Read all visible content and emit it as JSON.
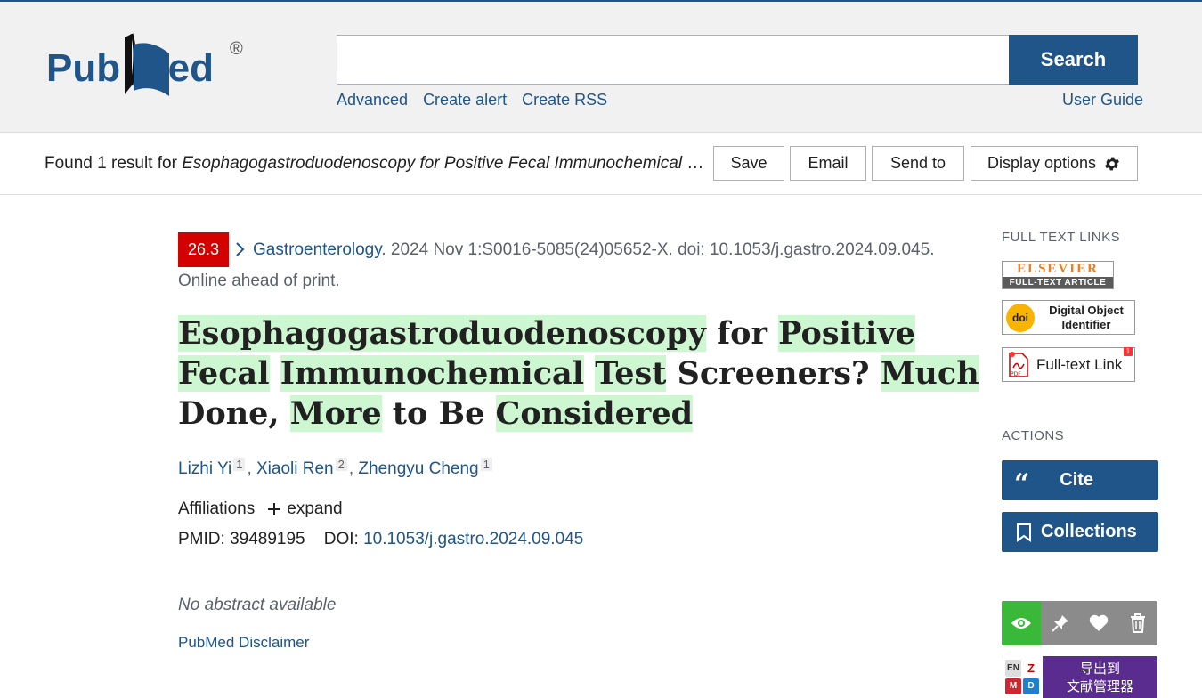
{
  "header": {
    "logo_text_left": "Pub",
    "logo_text_right": "Med",
    "logo_reg": "®",
    "search_value": "",
    "search_button": "Search",
    "links": [
      "Advanced",
      "Create alert",
      "Create RSS"
    ],
    "user_guide": "User Guide"
  },
  "results_bar": {
    "found_prefix": "Found 1 result for ",
    "query": "Esophagogastroduodenoscopy for Positive Fecal Immunochemical Test Screeners? Much Done, More to Be Considered",
    "save": "Save",
    "email": "Email",
    "send_to": "Send to",
    "display_options": "Display options"
  },
  "article": {
    "impact_factor": "26.3",
    "journal": "Gastroenterology",
    "citation": ". 2024 Nov 1:S0016-5085(24)05652-X. doi: 10.1053/j.gastro.2024.09.045.",
    "status": "Online ahead of print.",
    "title_words": [
      {
        "text": "Esophagogastroduodenoscopy",
        "hl": true
      },
      {
        "text": "for",
        "hl": false
      },
      {
        "text": "Positive",
        "hl": true
      },
      {
        "text": "Fecal",
        "hl": true
      },
      {
        "text": "Immunochemical",
        "hl": true
      },
      {
        "text": "Test",
        "hl": true
      },
      {
        "text": "Screeners?",
        "hl": false
      },
      {
        "text": "Much",
        "hl": true
      },
      {
        "text": "Done,",
        "hl": false
      },
      {
        "text": "More",
        "hl": true
      },
      {
        "text": "to",
        "hl": false
      },
      {
        "text": "Be",
        "hl": false
      },
      {
        "text": "Considered",
        "hl": true
      }
    ],
    "authors": [
      {
        "name": "Lizhi Yi",
        "aff": "1"
      },
      {
        "name": "Xiaoli Ren",
        "aff": "2"
      },
      {
        "name": "Zhengyu Cheng",
        "aff": "1"
      }
    ],
    "affiliations_label": "Affiliations",
    "expand_label": "expand",
    "pmid_label": "PMID:",
    "pmid": "39489195",
    "doi_label": "DOI:",
    "doi": "10.1053/j.gastro.2024.09.045",
    "abstract": "No abstract available",
    "disclaimer": "PubMed Disclaimer"
  },
  "sidebar": {
    "full_text_heading": "FULL TEXT LINKS",
    "elsevier_top": "ELSEVIER",
    "elsevier_bottom": "FULL-TEXT ARTICLE",
    "doi_badge": "doi",
    "doi_text": "Digital Object Identifier",
    "fulltext_link": "Full-text Link",
    "pdf_badge": "1",
    "actions_heading": "ACTIONS",
    "cite": "Cite",
    "collections": "Collections",
    "export_line1": "导出到",
    "export_line2": "文献管理器"
  },
  "colors": {
    "brand": "#20558a",
    "impact": "#d40000",
    "highlight": "#cdf7d0",
    "tool_active": "#3ab83a",
    "export": "#5b2c8f"
  }
}
